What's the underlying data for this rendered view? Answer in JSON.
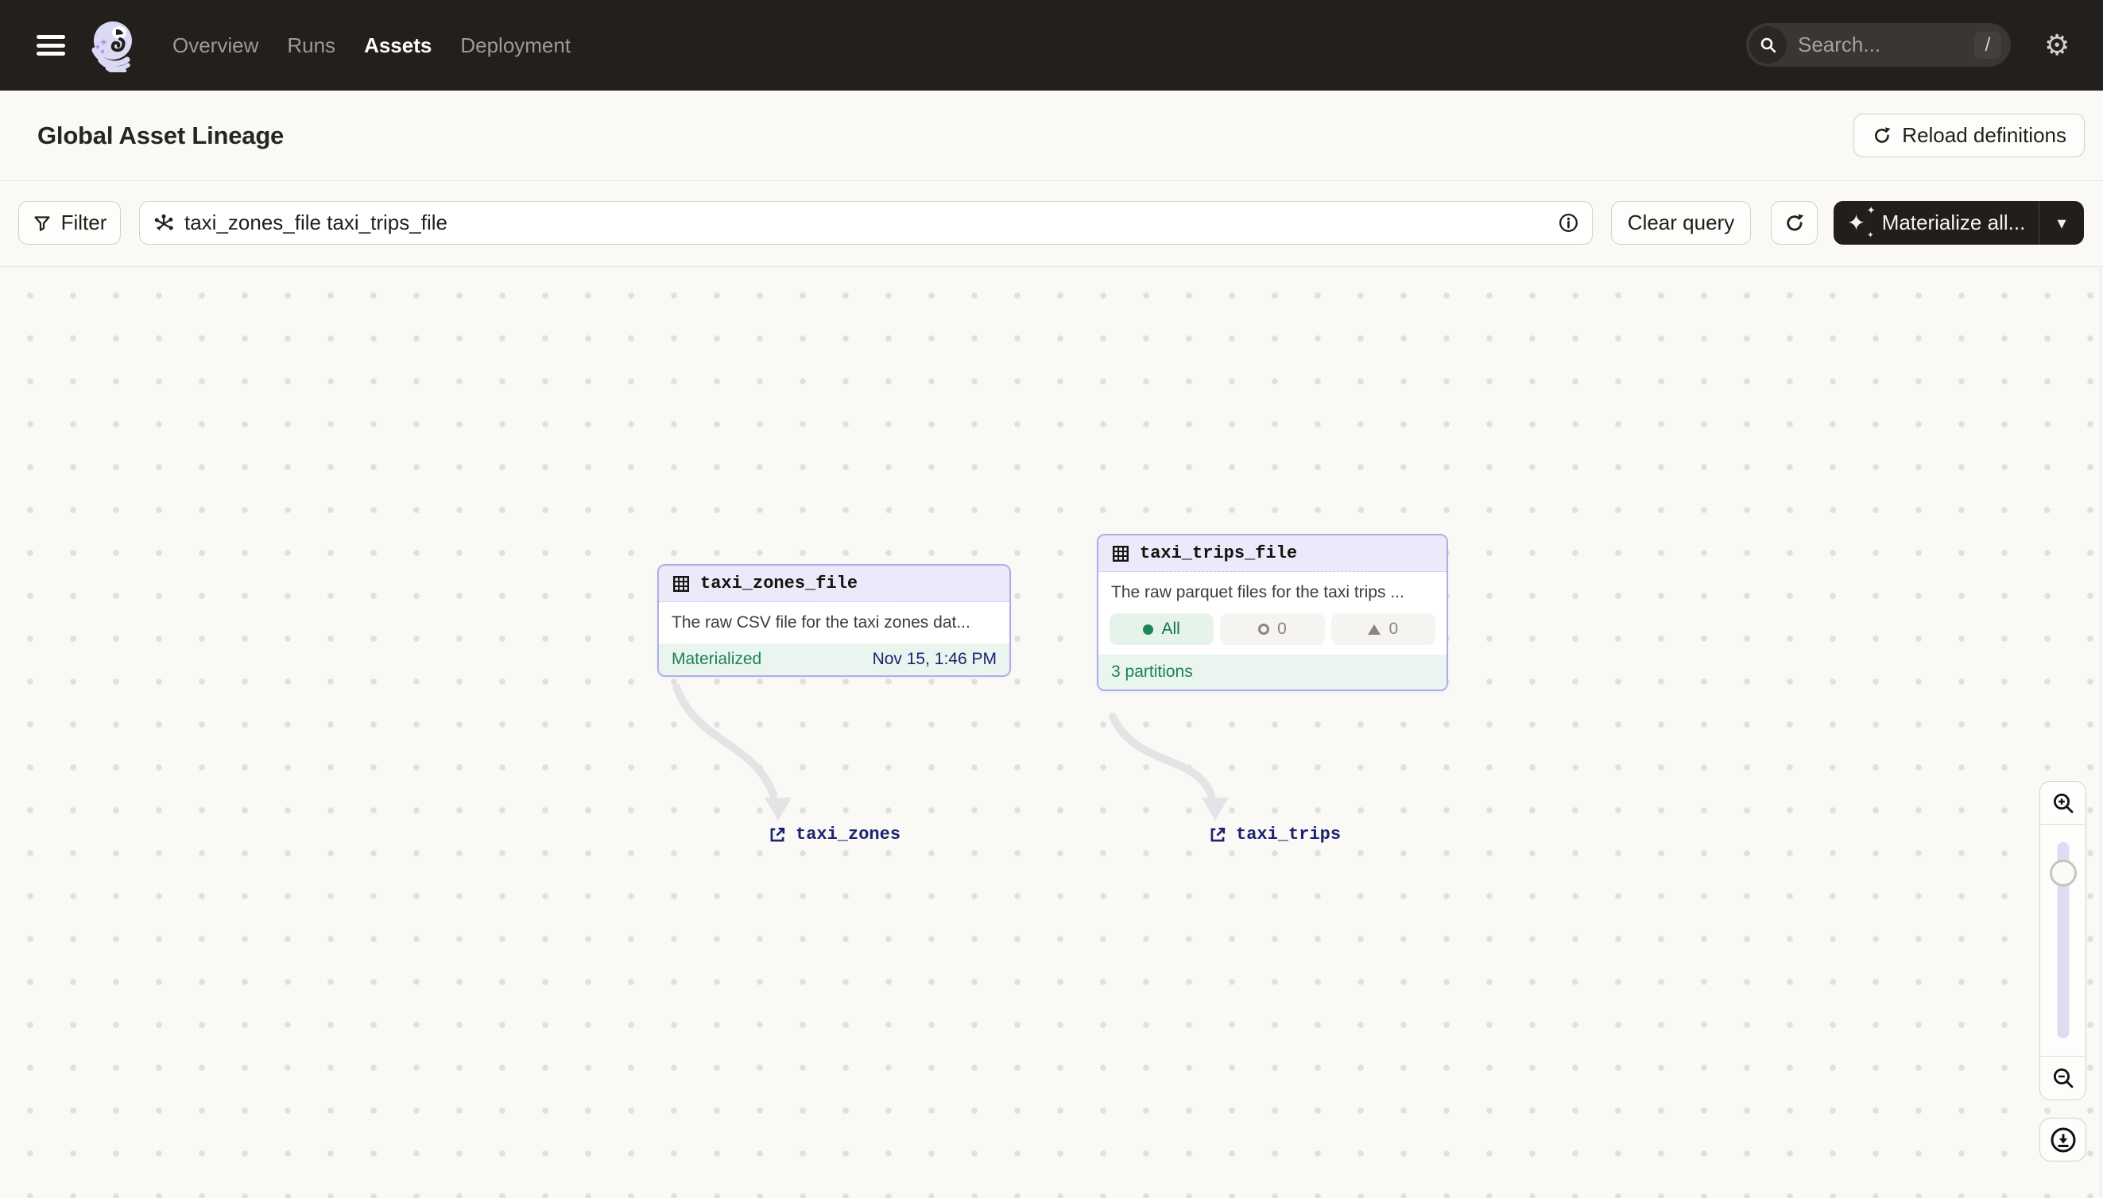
{
  "nav": {
    "menu_items": [
      {
        "label": "Overview",
        "active": false
      },
      {
        "label": "Runs",
        "active": false
      },
      {
        "label": "Assets",
        "active": true
      },
      {
        "label": "Deployment",
        "active": false
      }
    ],
    "search": {
      "placeholder": "Search...",
      "shortcut": "/"
    }
  },
  "header": {
    "title": "Global Asset Lineage",
    "reload_button": "Reload definitions"
  },
  "toolbar": {
    "filter_button": "Filter",
    "query_value": "taxi_zones_file taxi_trips_file",
    "clear_button": "Clear query",
    "materialize_button": "Materialize all..."
  },
  "graph": {
    "nodes": [
      {
        "name": "taxi_zones_file",
        "description": "The raw CSV file for the taxi zones dat...",
        "status": "Materialized",
        "timestamp": "Nov 15, 1:46 PM"
      },
      {
        "name": "taxi_trips_file",
        "description": "The raw parquet files for the taxi trips ...",
        "partition_badges": [
          {
            "label": "All",
            "state": "materialized"
          },
          {
            "label": "0",
            "state": "failed"
          },
          {
            "label": "0",
            "state": "stale"
          }
        ],
        "footer": "3 partitions"
      }
    ],
    "external_links": [
      {
        "label": "taxi_zones"
      },
      {
        "label": "taxi_trips"
      }
    ]
  },
  "icons": {
    "gear": "⚙",
    "caret_down": "▾",
    "sparkle": "✦"
  },
  "colors": {
    "nav_bg": "#231F1C",
    "page_bg": "#FAF9F6",
    "accent_purple": "#B3ABE8",
    "card_header_purple": "#ECEAFA",
    "green": "#1B8157",
    "green_bg": "#E9F5EE",
    "navy": "#1D2270",
    "gray_badge": "#898682"
  }
}
